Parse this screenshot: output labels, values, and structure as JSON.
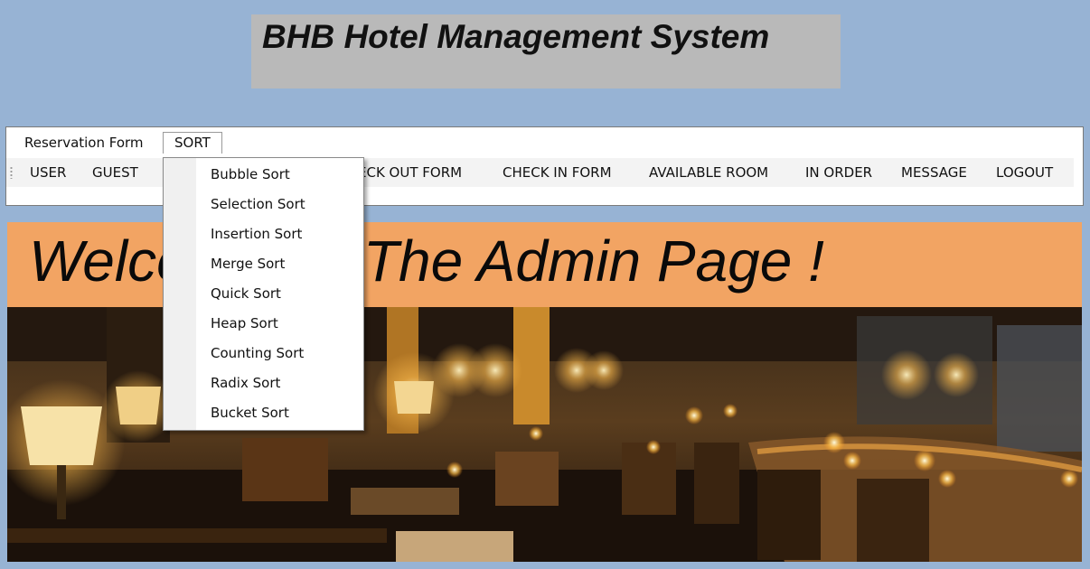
{
  "app": {
    "title": "BHB Hotel Management System"
  },
  "menubar": {
    "items": [
      {
        "label": "Reservation Form"
      },
      {
        "label": "SORT"
      }
    ]
  },
  "toolbar": {
    "items": [
      {
        "label": "USER"
      },
      {
        "label": "GUEST"
      },
      {
        "label": "ECK OUT FORM"
      },
      {
        "label": "CHECK IN FORM"
      },
      {
        "label": "AVAILABLE ROOM"
      },
      {
        "label": "IN ORDER"
      },
      {
        "label": "MESSAGE"
      },
      {
        "label": "LOGOUT"
      }
    ]
  },
  "sort_menu": {
    "items": [
      {
        "label": "Bubble Sort"
      },
      {
        "label": "Selection Sort"
      },
      {
        "label": "Insertion Sort"
      },
      {
        "label": "Merge Sort"
      },
      {
        "label": "Quick Sort"
      },
      {
        "label": "Heap Sort"
      },
      {
        "label": "Counting Sort"
      },
      {
        "label": "Radix Sort"
      },
      {
        "label": "Bucket Sort"
      }
    ]
  },
  "banner": {
    "text": "Welcome To The Admin Page !"
  },
  "colors": {
    "background": "#97b3d4",
    "title_box": "#b9b9b9",
    "banner": "#f2a463"
  }
}
